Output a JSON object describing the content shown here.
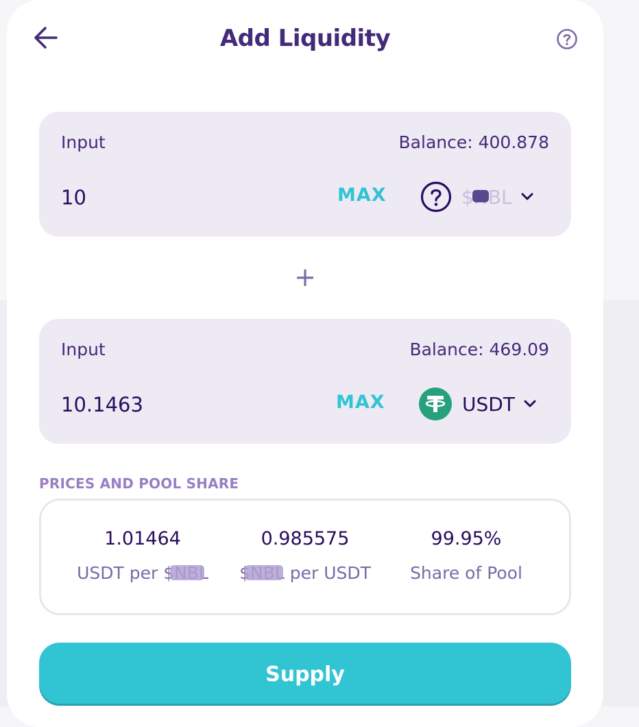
{
  "header": {
    "title": "Add Liquidity",
    "back_icon": "arrow-left-icon",
    "help_icon": "question-circle-icon"
  },
  "input_a": {
    "label": "Input",
    "balance": "Balance: 400.878",
    "amount": "10",
    "max_label": "MAX",
    "token_icon": "unknown-token-question-icon",
    "token_symbol": "$NBL",
    "chevron_icon": "chevron-down-icon"
  },
  "plus_icon": "+",
  "input_b": {
    "label": "Input",
    "balance": "Balance: 469.09",
    "amount": "10.1463",
    "max_label": "MAX",
    "token_icon": "tether-usdt-icon",
    "token_symbol": "USDT",
    "chevron_icon": "chevron-down-icon"
  },
  "prices": {
    "section_title": "PRICES AND POOL SHARE",
    "stats": [
      {
        "value": "1.01464",
        "label": "USDT per $NBL"
      },
      {
        "value": "0.985575",
        "label": "$NBL per USDT"
      },
      {
        "value": "99.95%",
        "label": "Share of Pool"
      }
    ]
  },
  "supply_label": "Supply",
  "colors": {
    "primary_text": "#280d5f",
    "accent": "#31c4d3",
    "panel_bg": "#eeeaf4",
    "secondary_text": "#7b6aa8",
    "tether": "#26a17b"
  }
}
